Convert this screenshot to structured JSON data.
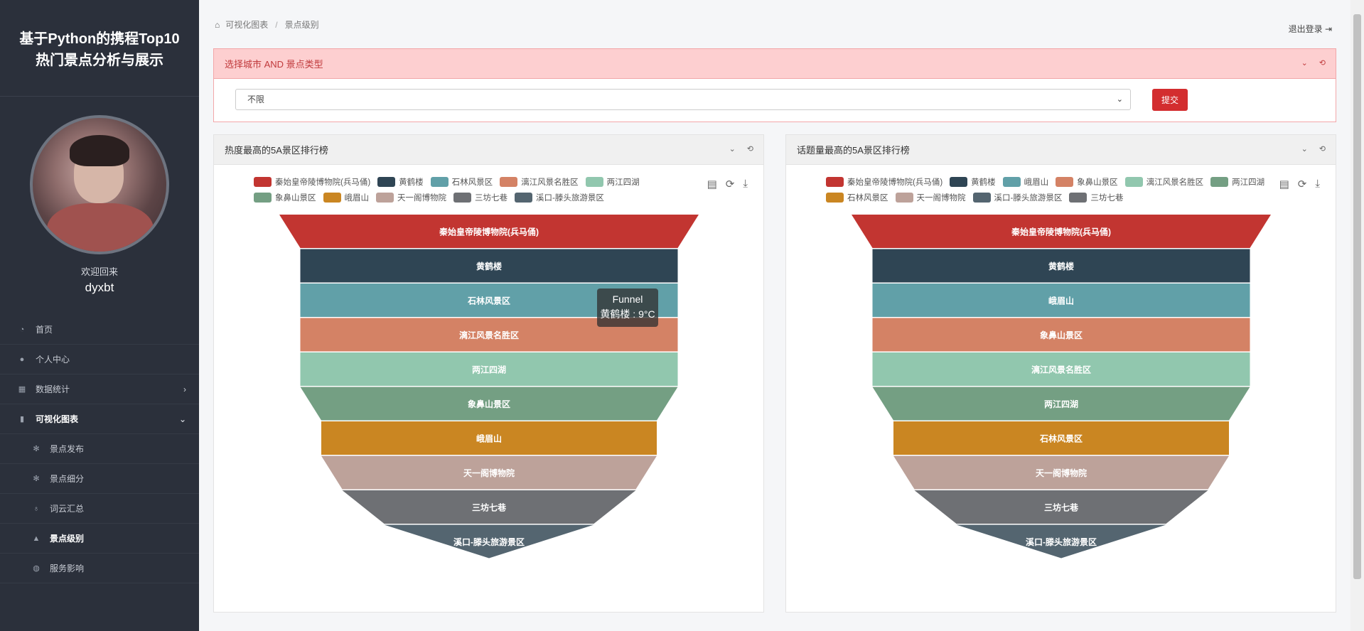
{
  "app": {
    "title_line1": "基于Python的携程Top10",
    "title_line2": "热门景点分析与展示"
  },
  "user": {
    "welcome": "欢迎回来",
    "name": "dyxbt"
  },
  "menu": [
    {
      "label": "首页",
      "icon": "gauge-icon",
      "glyph": "◔",
      "sub": false,
      "bold": false,
      "chev": ""
    },
    {
      "label": "个人中心",
      "icon": "user-icon",
      "glyph": "●",
      "sub": false,
      "bold": false,
      "chev": ""
    },
    {
      "label": "数据统计",
      "icon": "grid-icon",
      "glyph": "▦",
      "sub": false,
      "bold": false,
      "chev": "›"
    },
    {
      "label": "可视化图表",
      "icon": "bar-chart-icon",
      "glyph": "▮",
      "sub": false,
      "bold": true,
      "chev": "⌄"
    },
    {
      "label": "景点发布",
      "icon": "gear-icon",
      "glyph": "✻",
      "sub": true,
      "bold": false,
      "chev": ""
    },
    {
      "label": "景点细分",
      "icon": "gear-icon",
      "glyph": "✻",
      "sub": true,
      "bold": false,
      "chev": ""
    },
    {
      "label": "词云汇总",
      "icon": "lightbulb-icon",
      "glyph": "♁",
      "sub": true,
      "bold": false,
      "chev": ""
    },
    {
      "label": "景点级别",
      "icon": "graduation-cap-icon",
      "glyph": "▲",
      "sub": true,
      "bold": true,
      "chev": ""
    },
    {
      "label": "服务影响",
      "icon": "globe-icon",
      "glyph": "◍",
      "sub": true,
      "bold": false,
      "chev": ""
    }
  ],
  "breadcrumb": {
    "first": "可视化图表",
    "sep": "/",
    "second": "景点级别"
  },
  "logout_label": "退出登录",
  "filter": {
    "title": "选择城市 AND 景点类型",
    "select_value": "不限",
    "submit_label": "提交"
  },
  "colors": {
    "accent": "#d32d2f",
    "series": [
      "#c23531",
      "#2f4554",
      "#61a0a8",
      "#d48265",
      "#91c7ae",
      "#749f83",
      "#ca8622",
      "#bda29a",
      "#6e7074",
      "#546570"
    ]
  },
  "chart_data": [
    {
      "type": "funnel",
      "title": "热度最高的5A景区排行榜",
      "legend": [
        "秦始皇帝陵博物院(兵马俑)",
        "黄鹤楼",
        "石林风景区",
        "漓江风景名胜区",
        "两江四湖",
        "象鼻山景区",
        "峨眉山",
        "天一阁博物院",
        "三坊七巷",
        "溪口-滕头旅游景区"
      ],
      "categories": [
        "秦始皇帝陵博物院(兵马俑)",
        "黄鹤楼",
        "石林风景区",
        "漓江风景名胜区",
        "两江四湖",
        "象鼻山景区",
        "峨眉山",
        "天一阁博物院",
        "三坊七巷",
        "溪口-滕头旅游景区"
      ],
      "values": [
        10,
        9,
        9,
        9,
        9,
        9,
        8,
        8,
        7,
        5
      ],
      "tooltip": {
        "series": "Funnel",
        "text": "黄鹤楼 : 9°C"
      }
    },
    {
      "type": "funnel",
      "title": "话题量最高的5A景区排行榜",
      "legend": [
        "秦始皇帝陵博物院(兵马俑)",
        "黄鹤楼",
        "峨眉山",
        "象鼻山景区",
        "漓江风景名胜区",
        "两江四湖",
        "石林风景区",
        "天一阁博物院",
        "溪口-滕头旅游景区",
        "三坊七巷"
      ],
      "categories": [
        "秦始皇帝陵博物院(兵马俑)",
        "黄鹤楼",
        "峨眉山",
        "象鼻山景区",
        "漓江风景名胜区",
        "两江四湖",
        "石林风景区",
        "天一阁博物院",
        "三坊七巷",
        "溪口-滕头旅游景区"
      ],
      "values": [
        10,
        9,
        9,
        9,
        9,
        9,
        8,
        8,
        7,
        5
      ]
    }
  ]
}
